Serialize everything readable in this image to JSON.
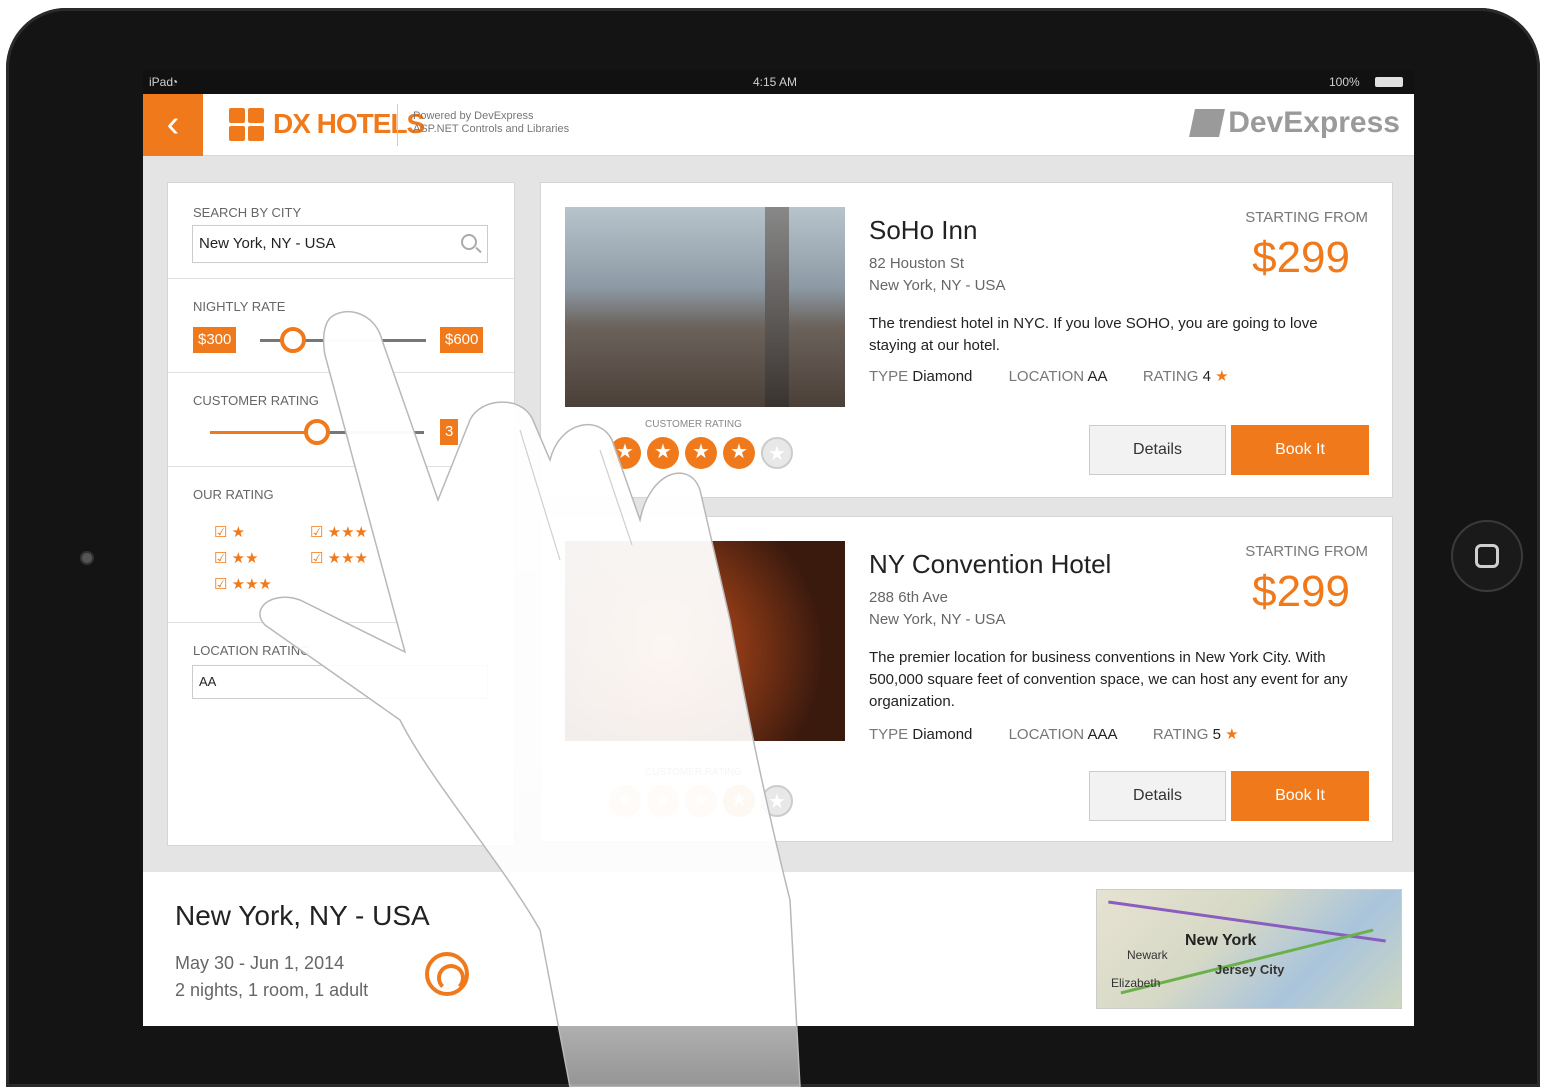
{
  "status_bar": {
    "carrier": "iPad",
    "time": "4:15 AM",
    "battery": "100%"
  },
  "header": {
    "back_glyph": "‹",
    "brand": "DX HOTELS",
    "powered_line1": "Powered by DevExpress",
    "powered_line2": "ASP.NET Controls and Libraries",
    "partner": "DevExpress"
  },
  "filters": {
    "search_label": "SEARCH BY CITY",
    "search_value": "New York, NY - USA",
    "nightly_label": "NIGHTLY RATE",
    "rate_min": "$300",
    "rate_max": "$600",
    "customer_rating_label": "CUSTOMER RATING",
    "customer_rating_value": "3",
    "our_rating_label": "OUR RATING",
    "our_rating_options": [
      "★",
      "★★",
      "★★★",
      "★★★",
      "★★★"
    ],
    "location_label": "LOCATION RATING",
    "location_value": "AA"
  },
  "hotels": [
    {
      "name": "SoHo Inn",
      "street": "82 Houston St",
      "city": "New York, NY - USA",
      "description": "The trendiest hotel in NYC. If you love SOHO, you are going to love staying at our hotel.",
      "type_label": "TYPE",
      "type": "Diamond",
      "location_label": "LOCATION",
      "location": "AA",
      "rating_label": "RATING",
      "rating": "4",
      "from_label": "STARTING FROM",
      "price": "$299",
      "customer_rating_label": "CUSTOMER RATING",
      "customer_stars": 4,
      "details_label": "Details",
      "book_label": "Book It"
    },
    {
      "name": "NY Convention Hotel",
      "street": "288 6th Ave",
      "city": "New York, NY - USA",
      "description": "The premier location for business conventions in New York City. With 500,000 square feet of convention space, we can host any event for any organization.",
      "type_label": "TYPE",
      "type": "Diamond",
      "location_label": "LOCATION",
      "location": "AAA",
      "rating_label": "RATING",
      "rating": "5",
      "from_label": "STARTING FROM",
      "price": "$299",
      "customer_rating_label": "CUSTOMER RATING",
      "customer_stars": 4,
      "details_label": "Details",
      "book_label": "Book It"
    }
  ],
  "footer": {
    "city": "New York, NY - USA",
    "dates": "May 30 - Jun 1, 2014",
    "guests": "2 nights, 1 room, 1 adult"
  },
  "map": {
    "labels": [
      "New York",
      "Jersey City",
      "Newark",
      "Elizabeth"
    ]
  },
  "colors": {
    "accent": "#f07a1b",
    "device": "#141414"
  },
  "icons": [
    "wifi-icon",
    "battery-icon",
    "back-icon",
    "search-icon",
    "star-icon",
    "checkbox-icon",
    "reset-icon",
    "home-button-icon"
  ]
}
